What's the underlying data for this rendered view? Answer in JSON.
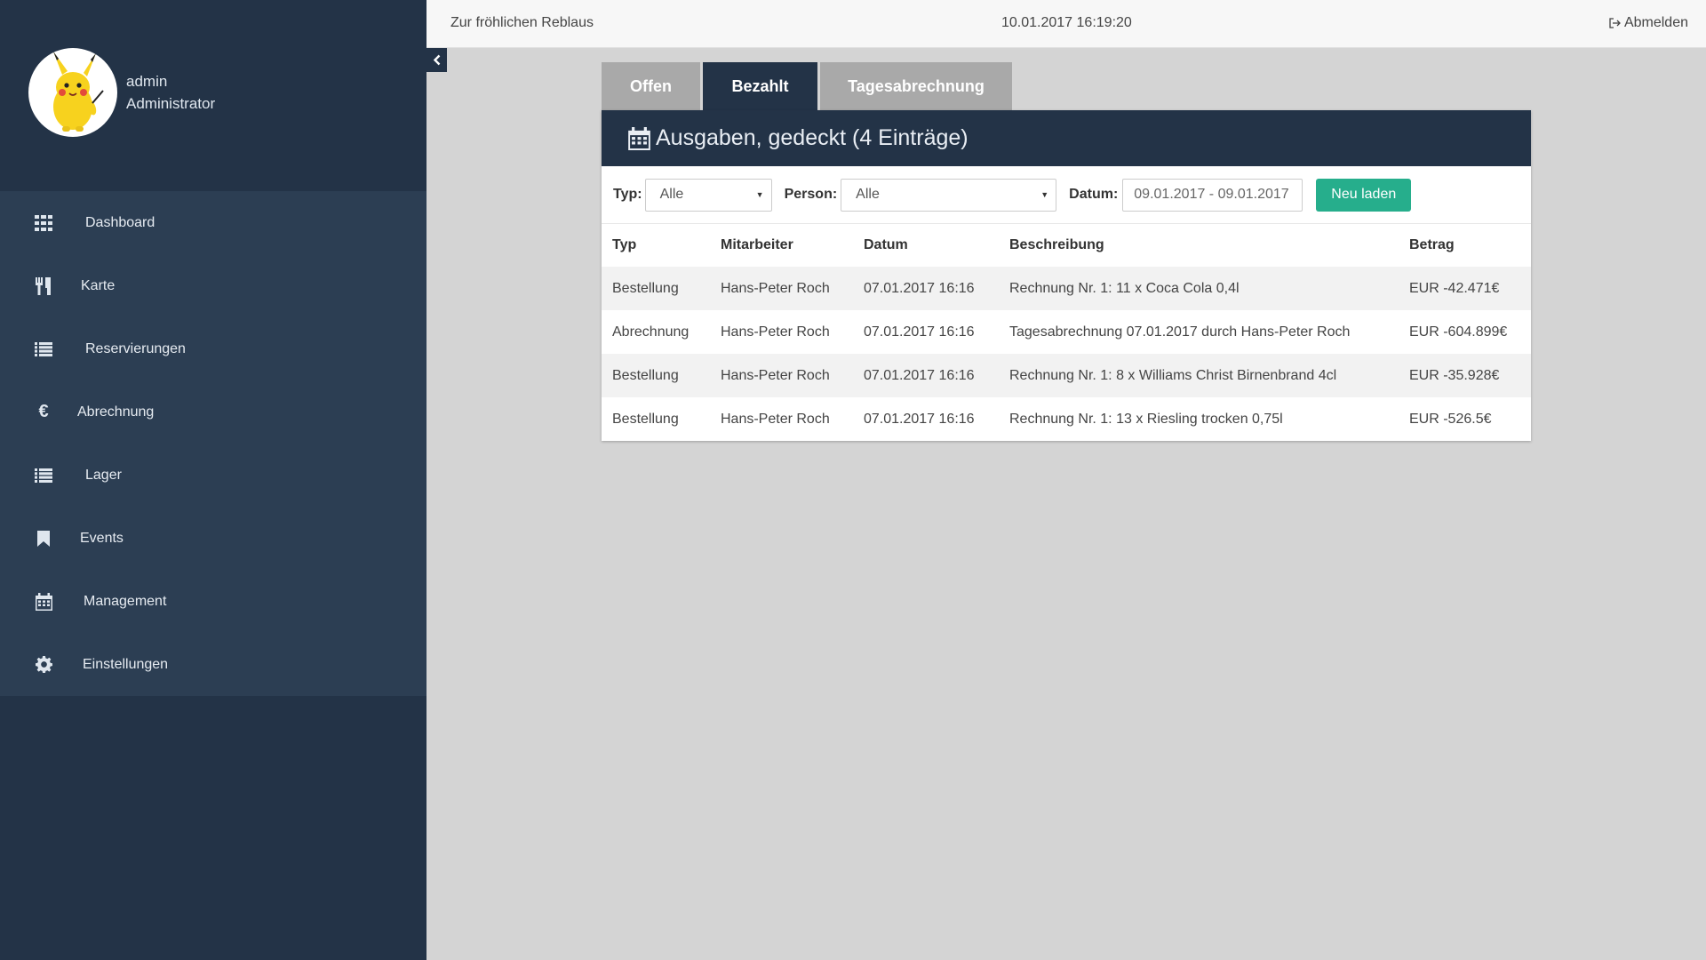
{
  "header": {
    "title": "Zur fröhlichen Reblaus",
    "datetime": "10.01.2017 16:19:20",
    "logout_label": "Abmelden"
  },
  "user": {
    "name": "admin",
    "role": "Administrator"
  },
  "sidebar": {
    "items": [
      {
        "label": "Dashboard",
        "icon": "grid-icon"
      },
      {
        "label": "Karte",
        "icon": "cutlery-icon"
      },
      {
        "label": "Reservierungen",
        "icon": "list-icon"
      },
      {
        "label": "Abrechnung",
        "icon": "euro-icon"
      },
      {
        "label": "Lager",
        "icon": "list-icon"
      },
      {
        "label": "Events",
        "icon": "bookmark-icon"
      },
      {
        "label": "Management",
        "icon": "calendar-icon"
      },
      {
        "label": "Einstellungen",
        "icon": "gear-icon"
      }
    ]
  },
  "tabs": [
    {
      "label": "Offen",
      "active": false
    },
    {
      "label": "Bezahlt",
      "active": true
    },
    {
      "label": "Tagesabrechnung",
      "active": false
    }
  ],
  "panel": {
    "title": "Ausgaben, gedeckt (4 Einträge)"
  },
  "filters": {
    "typ_label": "Typ:",
    "typ_value": "Alle",
    "person_label": "Person:",
    "person_value": "Alle",
    "datum_label": "Datum:",
    "datum_value": "09.01.2017 - 09.01.2017",
    "reload_label": "Neu laden"
  },
  "table": {
    "columns": [
      "Typ",
      "Mitarbeiter",
      "Datum",
      "Beschreibung",
      "Betrag"
    ],
    "rows": [
      [
        "Bestellung",
        "Hans-Peter Roch",
        "07.01.2017 16:16",
        "Rechnung Nr. 1: 11 x Coca Cola 0,4l",
        "EUR -42.471€"
      ],
      [
        "Abrechnung",
        "Hans-Peter Roch",
        "07.01.2017 16:16",
        "Tagesabrechnung 07.01.2017 durch Hans-Peter Roch",
        "EUR -604.899€"
      ],
      [
        "Bestellung",
        "Hans-Peter Roch",
        "07.01.2017 16:16",
        "Rechnung Nr. 1: 8 x Williams Christ Birnenbrand 4cl",
        "EUR -35.928€"
      ],
      [
        "Bestellung",
        "Hans-Peter Roch",
        "07.01.2017 16:16",
        "Rechnung Nr. 1: 13 x Riesling trocken 0,75l",
        "EUR -526.5€"
      ]
    ]
  },
  "colors": {
    "sidebar": "#233347",
    "nav_bg": "#2c3e53",
    "accent_button": "#26ae8c",
    "tab_inactive": "#a9a9a9",
    "page_bg": "#d4d4d4"
  }
}
